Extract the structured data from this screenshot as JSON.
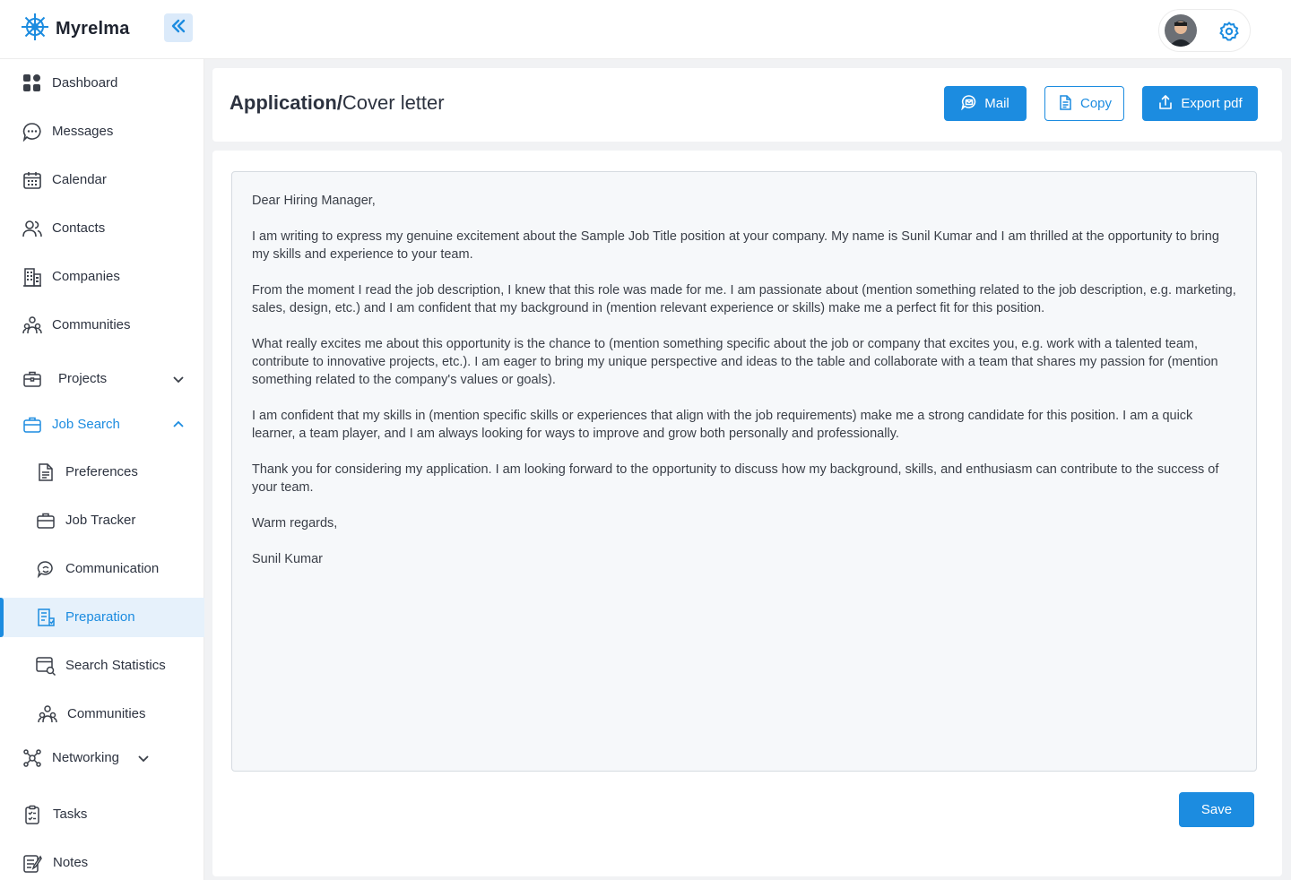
{
  "app": {
    "name": "Myrelma"
  },
  "sidebar": {
    "items": [
      {
        "label": "Dashboard"
      },
      {
        "label": "Messages"
      },
      {
        "label": "Calendar"
      },
      {
        "label": "Contacts"
      },
      {
        "label": "Companies"
      },
      {
        "label": "Communities"
      },
      {
        "label": "Projects"
      },
      {
        "label": "Job Search"
      },
      {
        "label": "Preferences"
      },
      {
        "label": "Job Tracker"
      },
      {
        "label": "Communication"
      },
      {
        "label": "Preparation"
      },
      {
        "label": "Search Statistics"
      },
      {
        "label": "Communities"
      },
      {
        "label": "Networking"
      },
      {
        "label": "Tasks"
      },
      {
        "label": "Notes"
      }
    ]
  },
  "header": {
    "title_main": "Application/",
    "title_sub": "Cover letter",
    "mail_label": "Mail",
    "copy_label": "Copy",
    "export_label": "Export pdf"
  },
  "letter": {
    "paragraphs": [
      "Dear Hiring Manager,",
      "I am writing to express my genuine excitement about the Sample Job Title position at your company. My name is Sunil Kumar and I am thrilled at the opportunity to bring my skills and experience to your team.",
      "From the moment I read the job description, I knew that this role was made for me. I am passionate about (mention something related to the job description, e.g. marketing, sales, design, etc.) and I am confident that my background in (mention relevant experience or skills) make me a perfect fit for this position.",
      "What really excites me about this opportunity is the chance to (mention something specific about the job or company that excites you, e.g. work with a talented team, contribute to innovative projects, etc.). I am eager to bring my unique perspective and ideas to the table and collaborate with a team that shares my passion for (mention something related to the company's values or goals).",
      "I am confident that my skills in (mention specific skills or experiences that align with the job requirements) make me a strong candidate for this position. I am a quick learner, a team player, and I am always looking for ways to improve and grow both personally and professionally.",
      "Thank you for considering my application. I am looking forward to the opportunity to discuss how my background, skills, and enthusiasm can contribute to the success of your team.",
      "Warm regards,",
      "Sunil Kumar"
    ]
  },
  "footer": {
    "save_label": "Save"
  },
  "colors": {
    "accent": "#1c8ce0",
    "active_bg": "#e6f1fb"
  }
}
